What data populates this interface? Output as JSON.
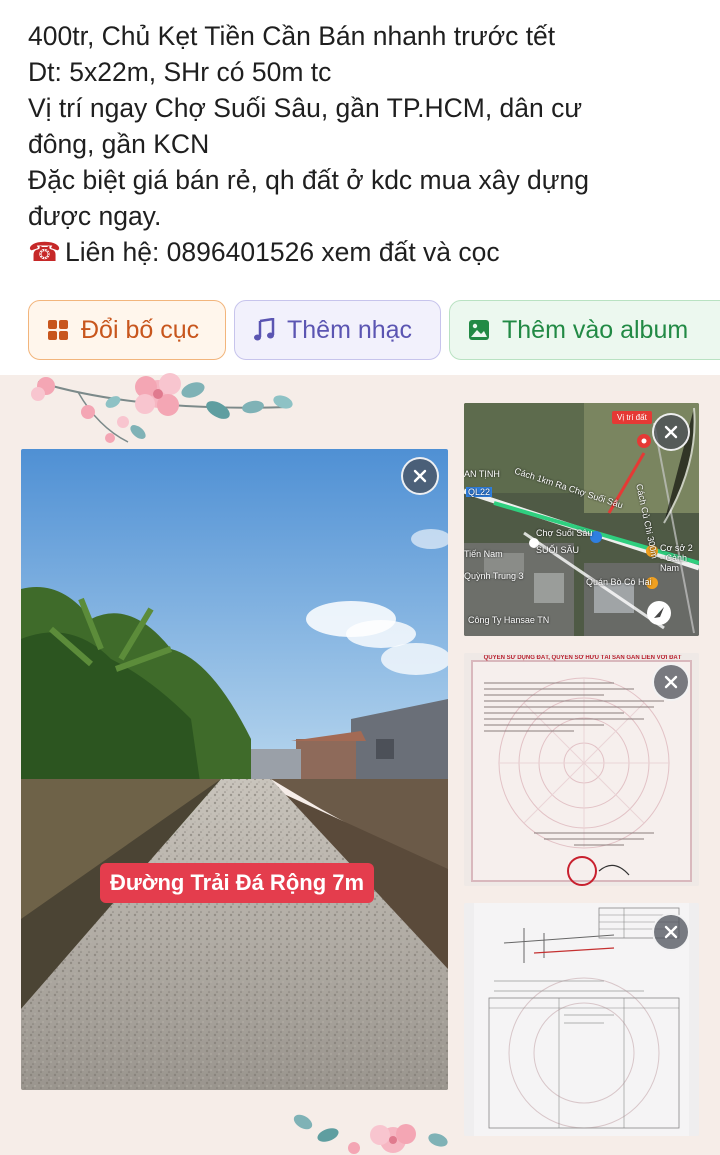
{
  "post": {
    "lines": [
      "400tr, Chủ Kẹt Tiền Cần Bán nhanh trước tết",
      "Dt: 5x22m, SHr có 50m tc",
      "Vị trí ngay Chợ Suối Sâu, gần TP.HCM, dân cư",
      "đông, gần KCN",
      "Đặc biệt giá bán rẻ, qh đất ở kdc mua xây dựng",
      "được ngay.",
      "Liên hệ: 0896401526 xem đất và cọc"
    ],
    "phone_icon": "☎"
  },
  "actions": {
    "layout": {
      "label": "Đổi bố cục",
      "icon": "grid-icon",
      "color": "#c8561d"
    },
    "music": {
      "label": "Thêm nhạc",
      "icon": "music-note-icon",
      "color": "#5b55b2"
    },
    "album": {
      "label": "Thêm vào album",
      "icon": "image-icon",
      "color": "#228a45"
    }
  },
  "photos": {
    "main": {
      "overlay_text": "Đường Trải Đá Rộng 7m"
    },
    "map": {
      "tag": "Vị trí đất",
      "route_label": "Cách 1km Ra Chợ Suối Sâu",
      "side_label": "Cách Củ Chi 300m",
      "poi_market": "Chợ Suối Sâu",
      "poi_area": "SUỐI SÂU",
      "poi_restaurant": "Quán Bò Cô Hai",
      "poi_company": "Công Ty Hansae TN",
      "poi_base": "Cơ sở 2 - Cảnh Nam",
      "poi_left1": "Tiến Nam",
      "poi_left2": "Quỳnh Trung 3",
      "poi_left3": "AN TỊNH",
      "road": "QL22"
    },
    "doc": {
      "title": "QUYỀN SỬ DỤNG ĐẤT, QUYỀN SỞ HỮU TÀI SẢN GẮN LIỀN VỚI ĐẤT"
    }
  },
  "colors": {
    "canvas": "#f6ede8",
    "road_label": "#e43d4d",
    "flower_pink": "#f4a6b4",
    "leaf": "#7fb2b6"
  }
}
